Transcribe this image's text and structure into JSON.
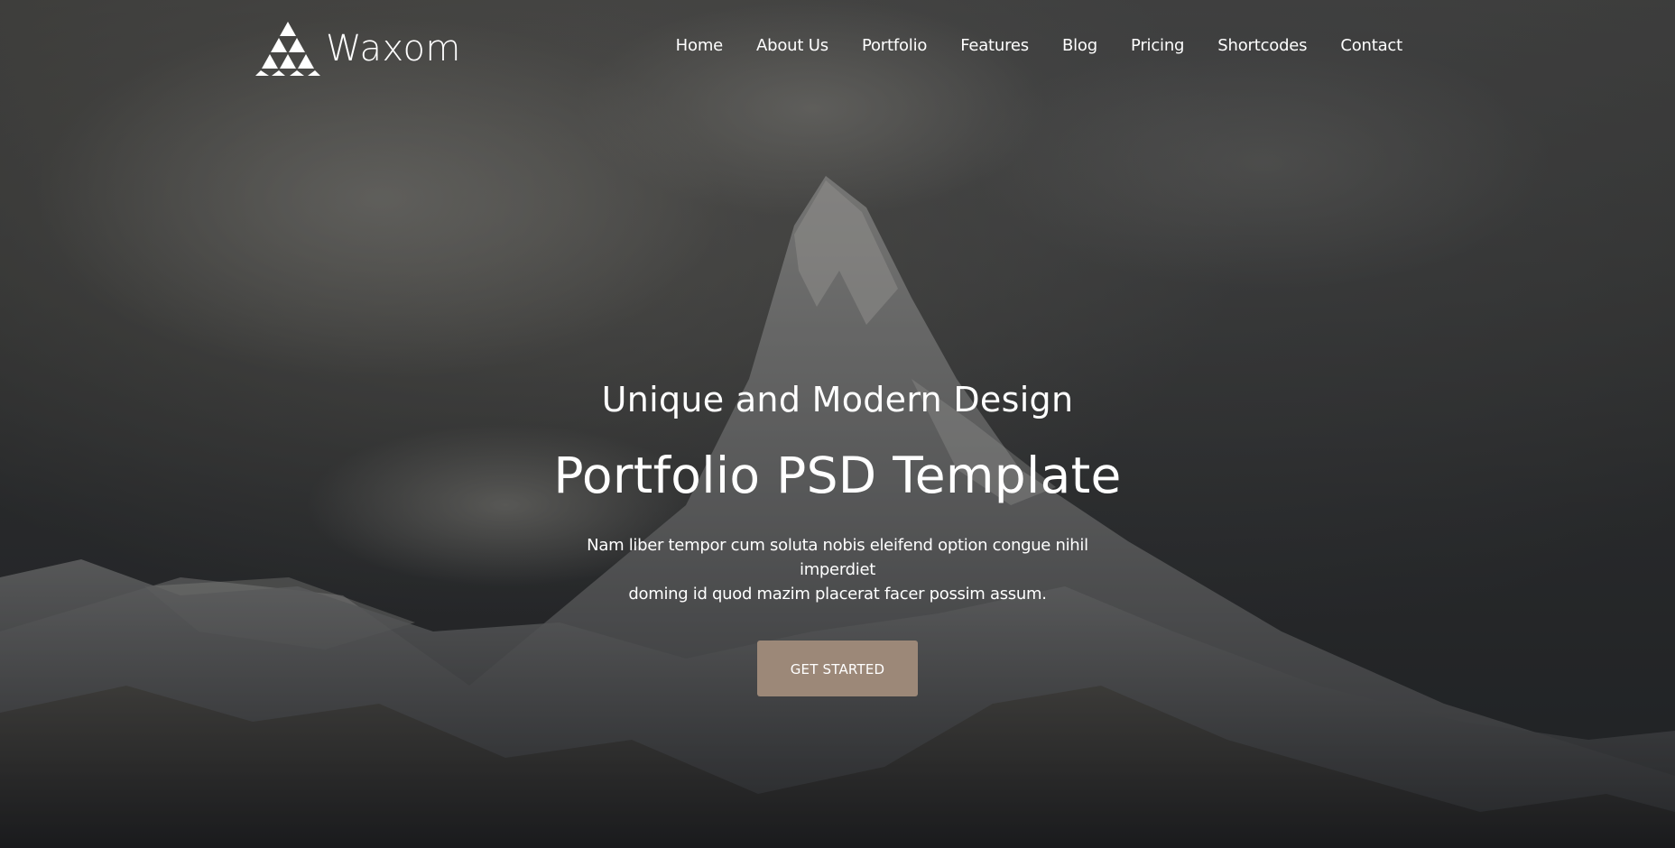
{
  "brand": {
    "name": "Waxom",
    "logo_icon": "triangle-mosaic-icon"
  },
  "nav": {
    "items": [
      {
        "label": "Home"
      },
      {
        "label": "About Us"
      },
      {
        "label": "Portfolio"
      },
      {
        "label": "Features"
      },
      {
        "label": "Blog"
      },
      {
        "label": "Pricing"
      },
      {
        "label": "Shortcodes"
      },
      {
        "label": "Contact"
      }
    ]
  },
  "hero": {
    "subtitle": "Unique and Modern Design",
    "title": "Portfolio PSD Template",
    "description_line1": "Nam liber tempor cum soluta nobis eleifend option congue nihil imperdiet",
    "description_line2": "doming id quod mazim placerat facer possim assum.",
    "cta_label": "GET STARTED"
  },
  "colors": {
    "accent": "#9c8878",
    "text": "#ffffff"
  }
}
